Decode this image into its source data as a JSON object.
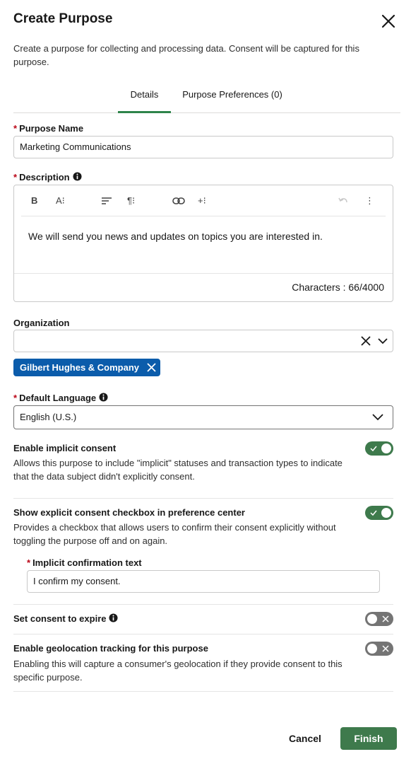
{
  "modal": {
    "title": "Create Purpose",
    "intro": "Create a purpose for collecting and processing data. Consent will be captured for this purpose."
  },
  "tabs": [
    {
      "label": "Details",
      "active": true
    },
    {
      "label": "Purpose Preferences (0)",
      "active": false
    }
  ],
  "purpose_name": {
    "label": "Purpose Name",
    "required": "*",
    "value": "Marketing Communications"
  },
  "description": {
    "label": "Description",
    "required": "*",
    "body": "We will send you news and updates on topics you are interested in.",
    "char_count": "Characters : 66/4000",
    "toolbar": {
      "bold": "B",
      "font_size": "A⁝",
      "align": "≡",
      "paragraph": "¶⁝",
      "add": "+⁝",
      "more": "⋮"
    }
  },
  "organization": {
    "label": "Organization",
    "selected_pill": "Gilbert Hughes & Company"
  },
  "default_language": {
    "label": "Default Language",
    "required": "*",
    "value": "English (U.S.)"
  },
  "toggles": {
    "implicit_consent": {
      "title": "Enable implicit consent",
      "description": "Allows this purpose to include \"implicit\" statuses and transaction types to indicate that the data subject didn't explicitly consent.",
      "on": true
    },
    "explicit_checkbox": {
      "title": "Show explicit consent checkbox in preference center",
      "description": "Provides a checkbox that allows users to confirm their consent explicitly without toggling the purpose off and on again.",
      "on": true
    },
    "consent_expire": {
      "title": "Set consent to expire",
      "on": false
    },
    "geolocation": {
      "title": "Enable geolocation tracking for this purpose",
      "description": "Enabling this will capture a consumer's geolocation if they provide consent to this specific purpose.",
      "on": false
    }
  },
  "implicit_confirmation": {
    "label": "Implicit confirmation text",
    "required": "*",
    "value": "I confirm my consent."
  },
  "footer": {
    "cancel_label": "Cancel",
    "finish_label": "Finish"
  },
  "colors": {
    "accent_green": "#3e7a4c",
    "pill_blue": "#0b5cab",
    "required_red": "#ba0517"
  }
}
